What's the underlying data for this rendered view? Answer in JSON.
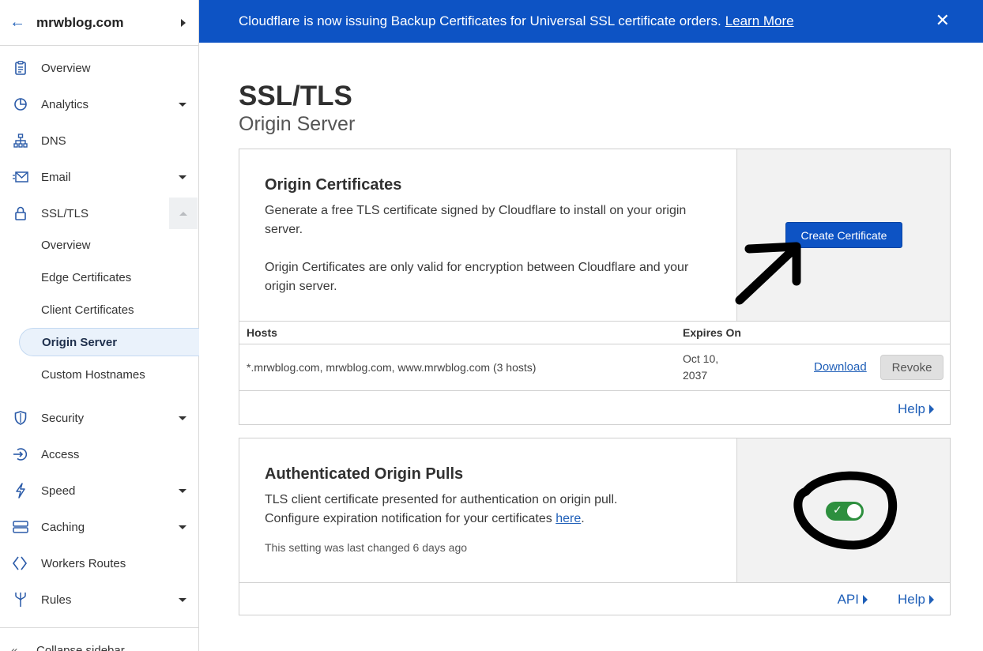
{
  "sidebar": {
    "domain": "mrwblog.com",
    "items": [
      {
        "label": "Overview",
        "icon": "clipboard-icon"
      },
      {
        "label": "Analytics",
        "icon": "pie-chart-icon"
      },
      {
        "label": "DNS",
        "icon": "sitemap-icon"
      },
      {
        "label": "Email",
        "icon": "envelope-icon"
      },
      {
        "label": "SSL/TLS",
        "icon": "lock-icon"
      },
      {
        "label": "Security",
        "icon": "shield-icon"
      },
      {
        "label": "Access",
        "icon": "access-icon"
      },
      {
        "label": "Speed",
        "icon": "lightning-icon"
      },
      {
        "label": "Caching",
        "icon": "server-stack-icon"
      },
      {
        "label": "Workers Routes",
        "icon": "workers-icon"
      },
      {
        "label": "Rules",
        "icon": "fork-icon"
      }
    ],
    "ssl_sub": [
      "Overview",
      "Edge Certificates",
      "Client Certificates",
      "Origin Server",
      "Custom Hostnames"
    ],
    "collapse_label": "Collapse sidebar"
  },
  "banner": {
    "text": "Cloudflare is now issuing Backup Certificates for Universal SSL certificate orders.",
    "link": "Learn More"
  },
  "page": {
    "title": "SSL/TLS",
    "subtitle": "Origin Server"
  },
  "origin_certs": {
    "title": "Origin Certificates",
    "desc1": "Generate a free TLS certificate signed by Cloudflare to install on your origin server.",
    "desc2": "Origin Certificates are only valid for encryption between Cloudflare and your origin server.",
    "create_button": "Create Certificate",
    "table": {
      "headers": [
        "Hosts",
        "Expires On"
      ],
      "rows": [
        {
          "hosts": "*.mrwblog.com, mrwblog.com, www.mrwblog.com (3 hosts)",
          "expires_line1": "Oct 10,",
          "expires_line2": "2037",
          "download": "Download",
          "revoke": "Revoke"
        }
      ]
    },
    "help": "Help"
  },
  "aop": {
    "title": "Authenticated Origin Pulls",
    "desc1": "TLS client certificate presented for authentication on origin pull.",
    "desc2_prefix": "Configure expiration notification for your certificates",
    "desc2_link": "here",
    "desc2_suffix": ".",
    "last_changed": "This setting was last changed 6 days ago",
    "toggle_on": true,
    "api": "API",
    "help": "Help"
  },
  "colors": {
    "accent": "#0d53c4",
    "toggle_on": "#2d8f3e",
    "link": "#1f5fb8"
  }
}
